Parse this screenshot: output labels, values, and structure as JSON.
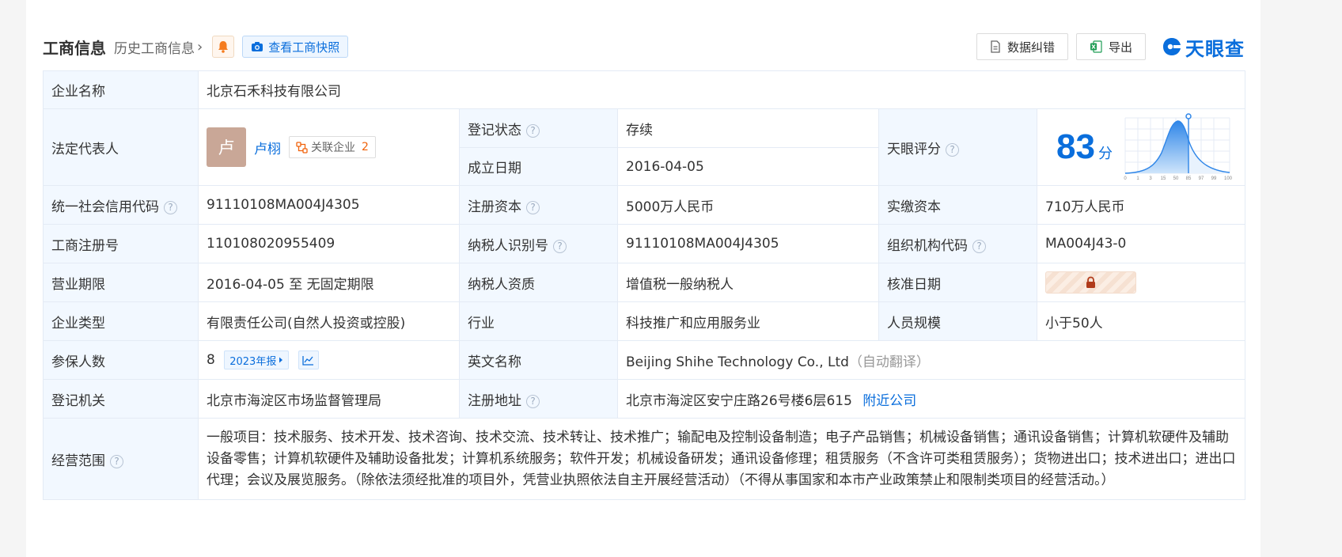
{
  "header": {
    "title": "工商信息",
    "history_label": "历史工商信息",
    "snapshot_label": "查看工商快照",
    "correction_label": "数据纠错",
    "export_label": "导出",
    "logo_text": "天眼查"
  },
  "colors": {
    "accent": "#0a6edc",
    "label_bg": "#f2f8ff",
    "status_green": "#23a653",
    "count_orange": "#f0620a"
  },
  "table": {
    "company_name_label": "企业名称",
    "company_name": "北京石禾科技有限公司",
    "legal_rep_label": "法定代表人",
    "legal_rep_avatar": "卢",
    "legal_rep_name": "卢栩",
    "related_label": "关联企业",
    "related_count": "2",
    "status_label": "登记状态",
    "status_value": "存续",
    "founded_label": "成立日期",
    "founded_value": "2016-04-05",
    "score_label": "天眼评分",
    "score_value": "83",
    "score_unit": "分",
    "score_axis_ticks": [
      "0",
      "1",
      "3",
      "15",
      "50",
      "85",
      "97",
      "99",
      "100"
    ],
    "credit_code_label": "统一社会信用代码",
    "credit_code": "91110108MA004J4305",
    "reg_capital_label": "注册资本",
    "reg_capital": "5000万人民币",
    "paid_capital_label": "实缴资本",
    "paid_capital": "710万人民币",
    "reg_no_label": "工商注册号",
    "reg_no": "110108020955409",
    "taxpayer_id_label": "纳税人识别号",
    "taxpayer_id": "91110108MA004J4305",
    "org_code_label": "组织机构代码",
    "org_code": "MA004J43-0",
    "term_label": "营业期限",
    "term_value": "2016-04-05 至 无固定期限",
    "taxpayer_qual_label": "纳税人资质",
    "taxpayer_qual": "增值税一般纳税人",
    "approve_date_label": "核准日期",
    "type_label": "企业类型",
    "type_value": "有限责任公司(自然人投资或控股)",
    "industry_label": "行业",
    "industry_value": "科技推广和应用服务业",
    "staff_label": "人员规模",
    "staff_value": "小于50人",
    "insured_label": "参保人数",
    "insured_value": "8",
    "insured_year_tag": "2023年报",
    "english_name_label": "英文名称",
    "english_name": "Beijing Shihe Technology Co., Ltd",
    "auto_translate": "（自动翻译）",
    "authority_label": "登记机关",
    "authority_value": "北京市海淀区市场监督管理局",
    "address_label": "注册地址",
    "address_value": "北京市海淀区安宁庄路26号楼6层615",
    "nearby_label": "附近公司",
    "scope_label": "经营范围",
    "scope_value": "一般项目：技术服务、技术开发、技术咨询、技术交流、技术转让、技术推广；输配电及控制设备制造；电子产品销售；机械设备销售；通讯设备销售；计算机软硬件及辅助设备零售；计算机软硬件及辅助设备批发；计算机系统服务；软件开发；机械设备研发；通讯设备修理；租赁服务（不含许可类租赁服务）；货物进出口；技术进出口；进出口代理；会议及展览服务。（除依法须经批准的项目外，凭营业执照依法自主开展经营活动）（不得从事国家和本市产业政策禁止和限制类项目的经营活动。）"
  }
}
